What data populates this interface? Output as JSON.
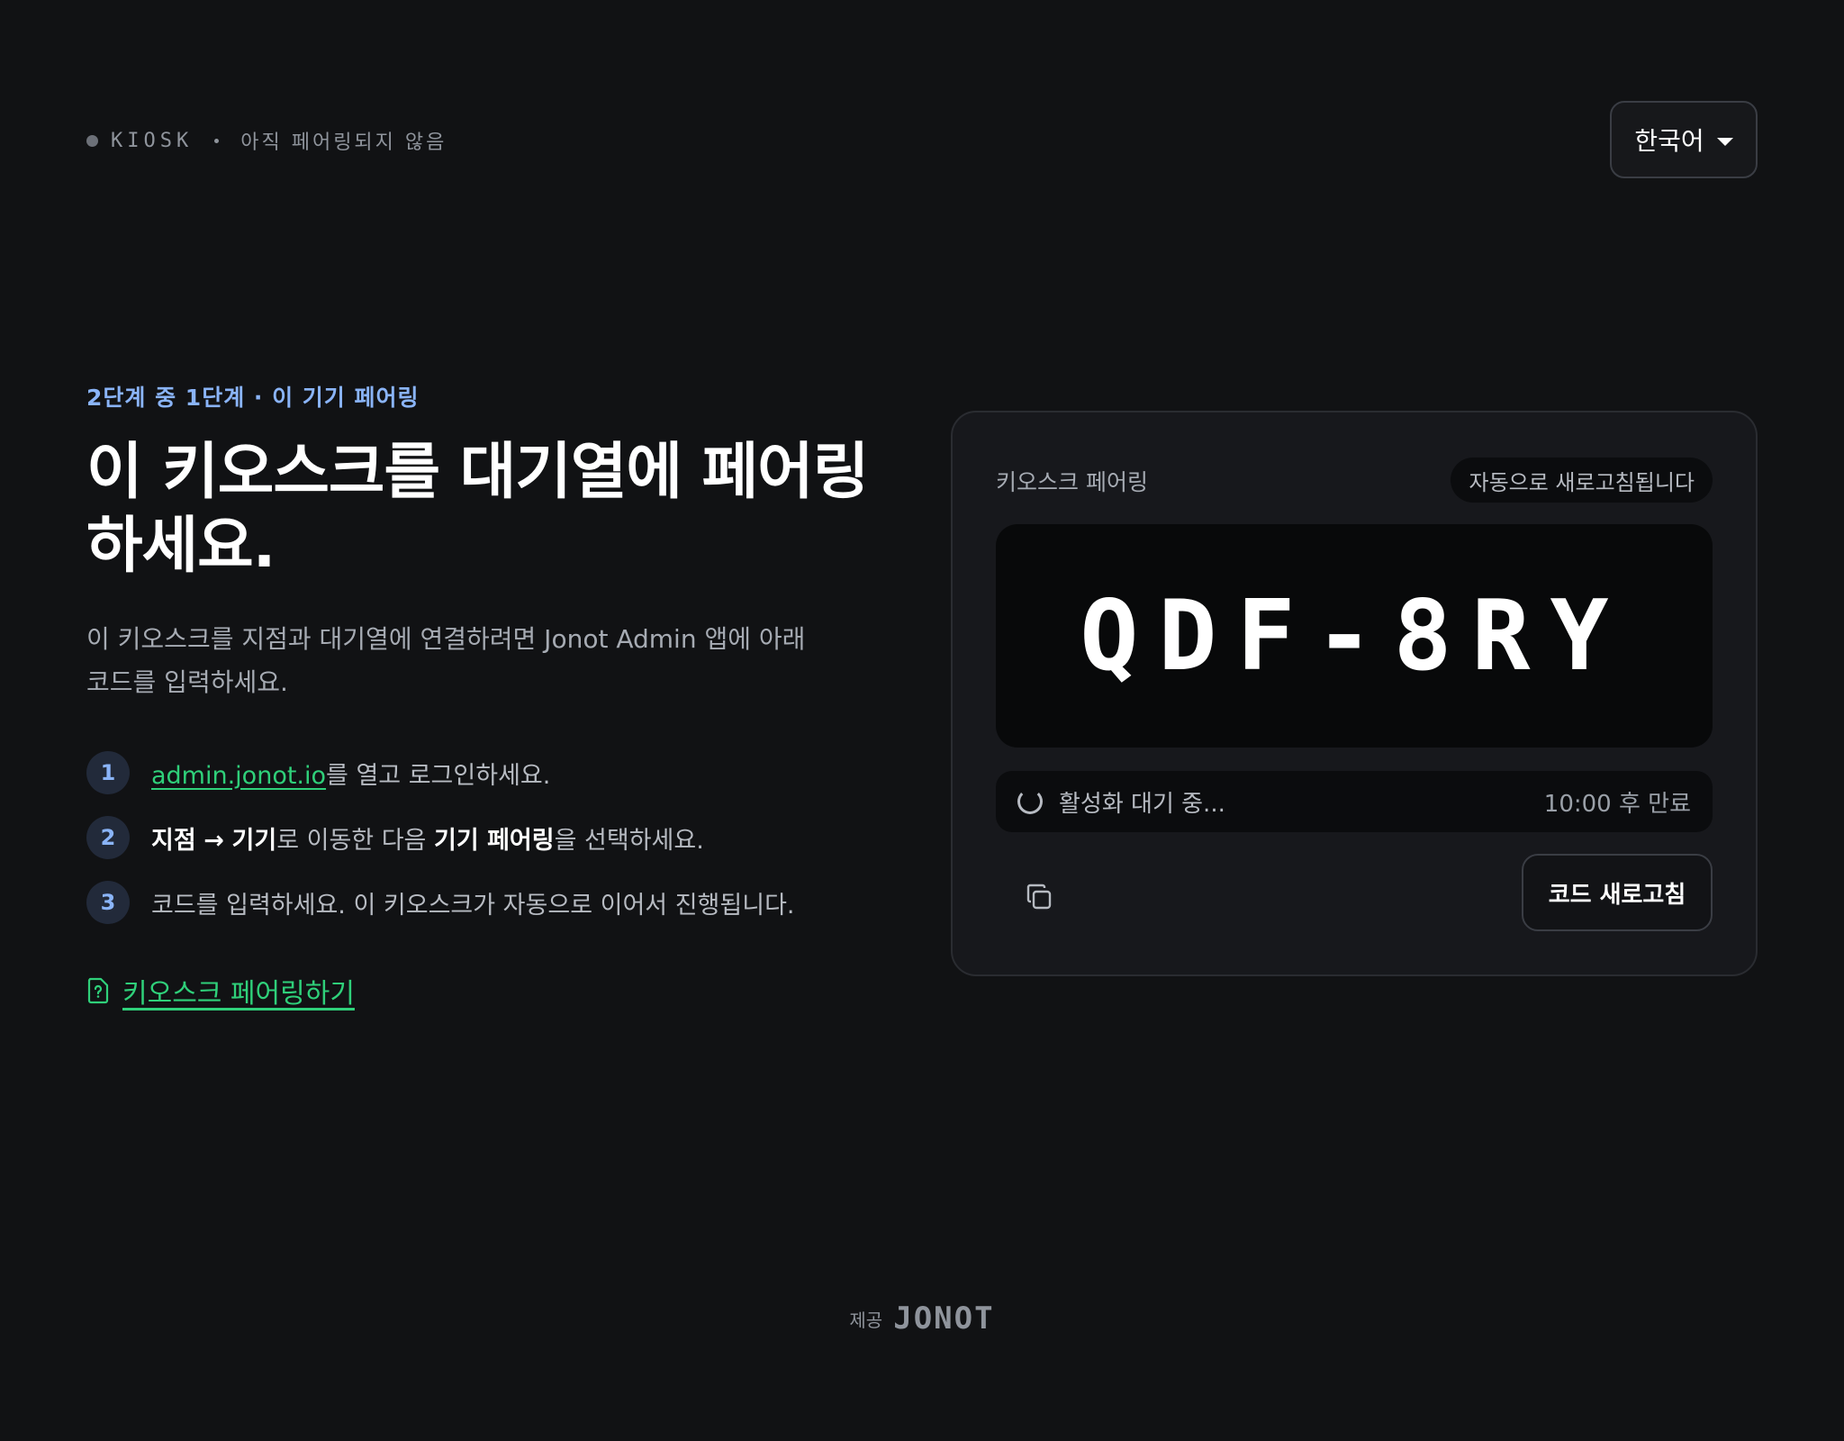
{
  "topbar": {
    "device_label": "KIOSK",
    "pair_status": "아직 페어링되지 않음"
  },
  "language": {
    "selected": "한국어"
  },
  "intro": {
    "step_label": "2단계 중 1단계 · 이 기기 페어링",
    "headline": "이 키오스크를 대기열에 페어링하세요.",
    "description": "이 키오스크를 지점과 대기열에 연결하려면 Jonot Admin 앱에 아래 코드를 입력하세요."
  },
  "steps": [
    {
      "number": "1",
      "link_text": "admin.jonot.io",
      "text_after": "를 열고 로그인하세요."
    },
    {
      "number": "2",
      "bold_1": "지점",
      "arrow": "→",
      "bold_2": "기기",
      "text_mid": "로 이동한 다음 ",
      "bold_3": "기기 페어링",
      "text_after": "을 선택하세요."
    },
    {
      "number": "3",
      "text": "코드를 입력하세요. 이 키오스크가 자동으로 이어서 진행됩니다."
    }
  ],
  "help_link": {
    "label": "키오스크 페어링하기",
    "icon": "help-document-icon"
  },
  "card": {
    "title": "키오스크 페어링",
    "auto_refresh_badge": "자동으로 새로고침됩니다",
    "pairing_code": "QDF-8RY",
    "status_text": "활성화 대기 중...",
    "expires_text": "10:00 후 만료",
    "copy_icon": "copy-icon",
    "refresh_button": "코드 새로고침"
  },
  "footer": {
    "provided_by": "제공",
    "brand": "JONOT"
  },
  "colors": {
    "background": "#111214",
    "card": "#17181c",
    "accent_blue": "#8ab4f8",
    "accent_green": "#2fd07a"
  }
}
